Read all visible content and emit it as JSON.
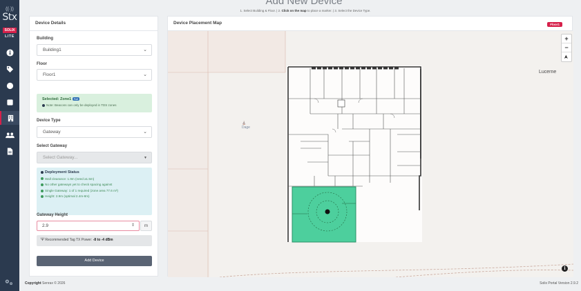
{
  "app": {
    "logo_signal": "((·))",
    "logo_text": "Stx",
    "logo_badge": "SOLIX",
    "logo_sub": "LITE",
    "colors": {
      "brand": "#d6204a",
      "sidebar": "#2b3a4f",
      "zone": "#3ecb95"
    }
  },
  "sidebar": {
    "items": [
      {
        "icon": "info-icon",
        "active": false
      },
      {
        "icon": "tag-icon",
        "active": false
      },
      {
        "icon": "circle-icon",
        "active": false
      },
      {
        "icon": "square-icon",
        "active": false
      },
      {
        "icon": "building-icon",
        "active": true
      },
      {
        "icon": "users-icon",
        "active": false
      },
      {
        "icon": "document-icon",
        "active": false
      }
    ],
    "footer_icon": "settings-icon"
  },
  "header": {
    "title": "Add New Device",
    "steps_1": "1. Select Building & Floor.",
    "steps_sep": " | 2. ",
    "steps_bold": "Click on the map",
    "steps_2": " to place a marker. | 3. Select the Device Type."
  },
  "details": {
    "heading": "Device Details",
    "building_label": "Building",
    "building_value": "Building1",
    "floor_label": "Floor",
    "floor_value": "Floor1",
    "selected_prefix": "Selected: ",
    "selected_zone": "Zone1",
    "selected_tag": "Full",
    "zone_note": "Note: Beacons can only be deployed in TDS zones",
    "device_type_label": "Device Type",
    "device_type_value": "Gateway",
    "select_gateway_label": "Select Gateway",
    "select_gateway_placeholder": "Select Gateway...",
    "deployment": {
      "title": "Deployment Status",
      "lines": [
        "Wall clearance: 1.9m (need ≥1.5m)",
        "No other gateways yet to check spacing against",
        "Single Gateway: 1 of 1 required (zone area 77.6 m²)",
        "Height: 2.9m (optimal 2.4m-8m)"
      ]
    },
    "height_label": "Gateway Height",
    "height_value": "2.9",
    "height_unit": "m",
    "tx_prefix": "Recommended Tag TX Power: ",
    "tx_value": "-8 to -4 dBm",
    "add_button": "Add Device"
  },
  "map": {
    "heading": "Device Placement Map",
    "floor_badge": "Floor1",
    "city_label": "Lucerne",
    "poi_label": "Dage",
    "zoom_in": "+",
    "zoom_out": "−",
    "compass": "➤",
    "info": "i"
  },
  "footer": {
    "copyright_bold": "Copyright",
    "copyright": " Senrax © 2026",
    "version": "Solix Portal Version 2.9.2"
  }
}
